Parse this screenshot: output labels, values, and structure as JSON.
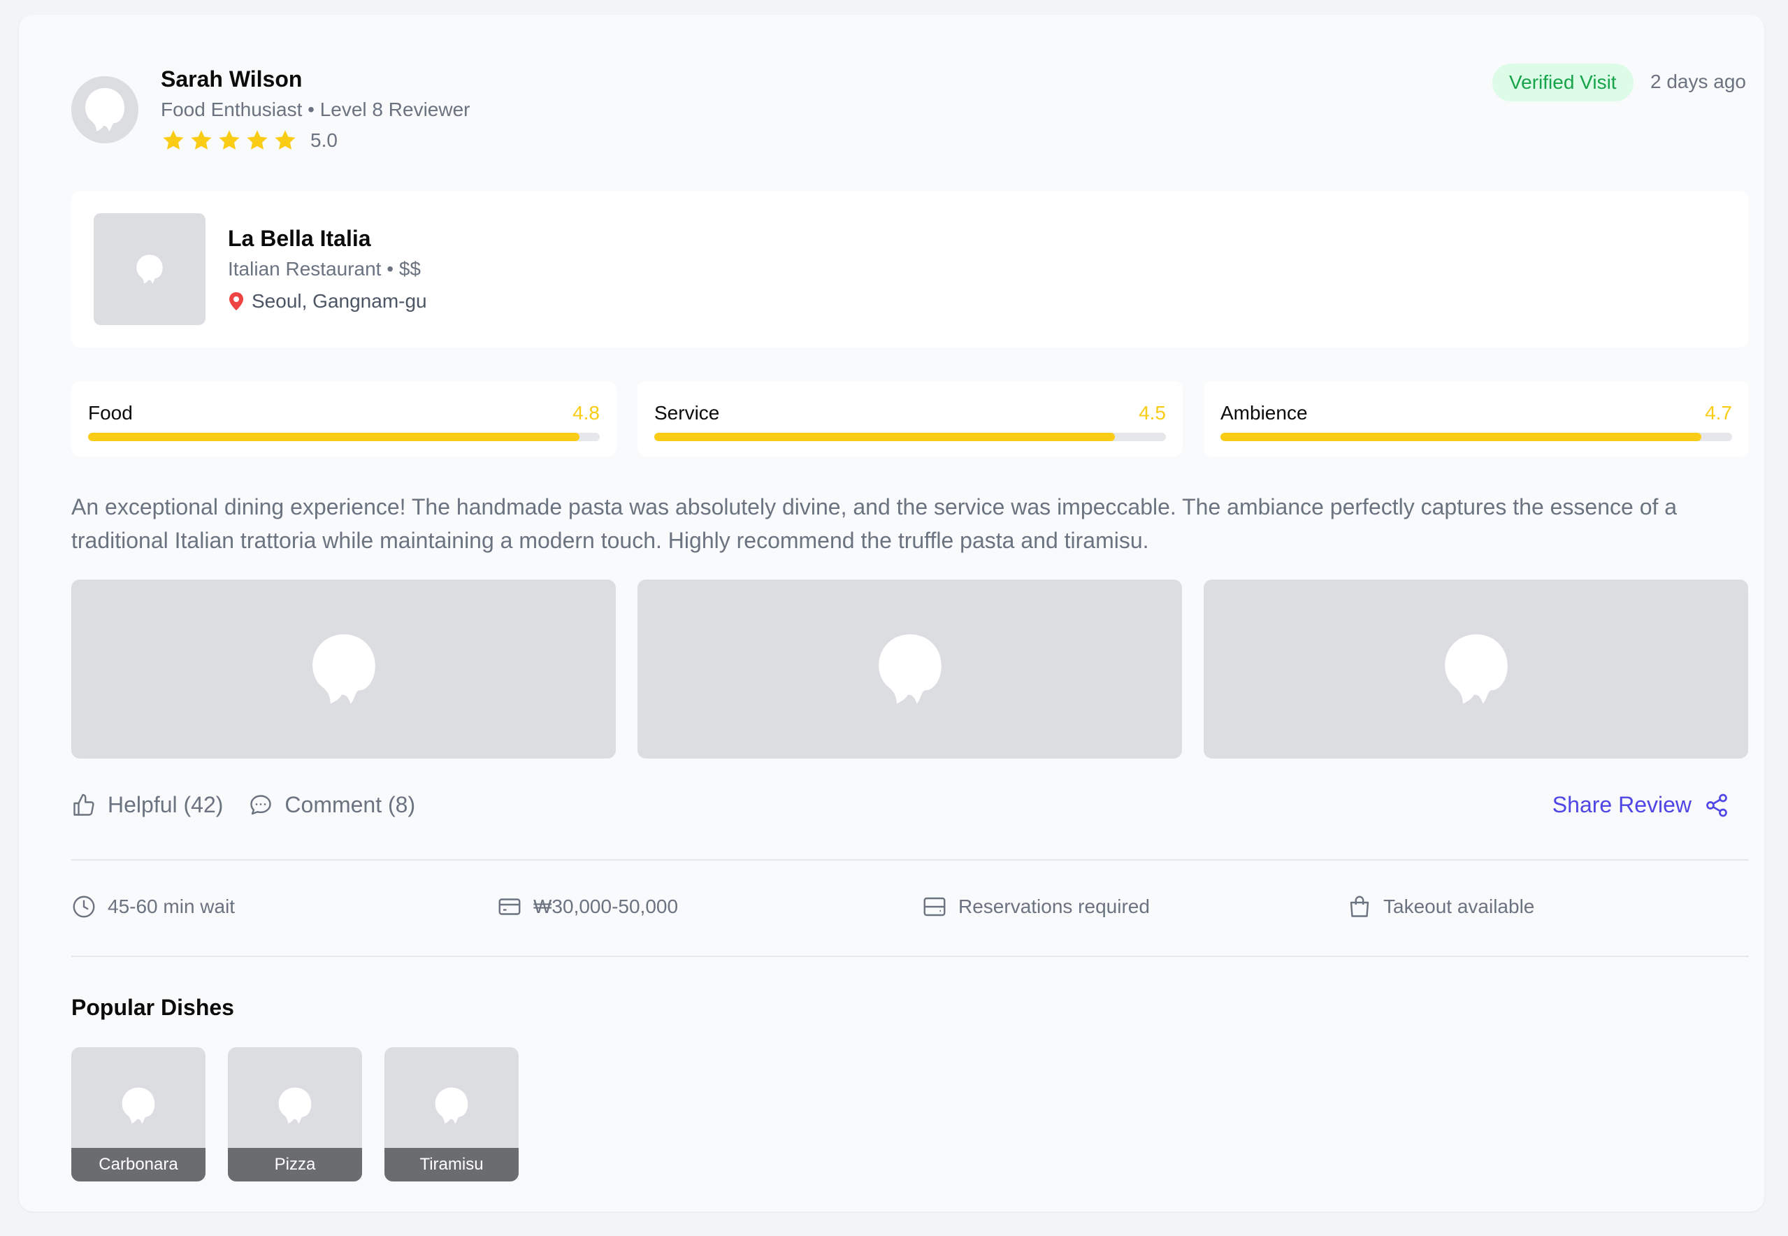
{
  "reviewer": {
    "name": "Sarah Wilson",
    "title": "Food Enthusiast",
    "level": "Level 8 Reviewer",
    "rating": 5,
    "rating_label": "5.0",
    "badge": "Verified Visit",
    "time_ago": "2 days ago"
  },
  "restaurant": {
    "name": "La Bella Italia",
    "category": "Italian Restaurant",
    "price": "$$",
    "location": "Seoul, Gangnam-gu"
  },
  "scores": [
    {
      "label": "Food",
      "value": "4.8",
      "fraction": 0.96
    },
    {
      "label": "Service",
      "value": "4.5",
      "fraction": 0.9
    },
    {
      "label": "Ambience",
      "value": "4.7",
      "fraction": 0.94
    }
  ],
  "review_text": "An exceptional dining experience! The handmade pasta was absolutely divine, and the service was impeccable. The ambiance perfectly captures the essence of a traditional Italian trattoria while maintaining a modern touch. Highly recommend the truffle pasta and tiramisu.",
  "actions": {
    "helpful": "Helpful (42)",
    "comment": "Comment (8)",
    "share": "Share Review"
  },
  "info": {
    "wait": "45-60 min wait",
    "price_range": "₩30,000-50,000",
    "reservations": "Reservations required",
    "takeout": "Takeout available"
  },
  "popular": {
    "title": "Popular Dishes",
    "dishes": [
      "Carbonara",
      "Pizza",
      "Tiramisu"
    ]
  },
  "colors": {
    "accent": "#4f46e5",
    "star": "#facc15",
    "verified_bg": "#dcfce7",
    "verified_text": "#16a34a",
    "location_pin": "#ef4444"
  },
  "icons": {
    "helpful": "thumbs-up-icon",
    "comment": "comment-icon",
    "share": "share-icon",
    "wait": "clock-icon",
    "price": "credit-card-icon",
    "reservations": "reservation-icon",
    "takeout": "shopping-bag-icon",
    "location": "map-pin-icon",
    "placeholder": "image-placeholder-icon"
  }
}
